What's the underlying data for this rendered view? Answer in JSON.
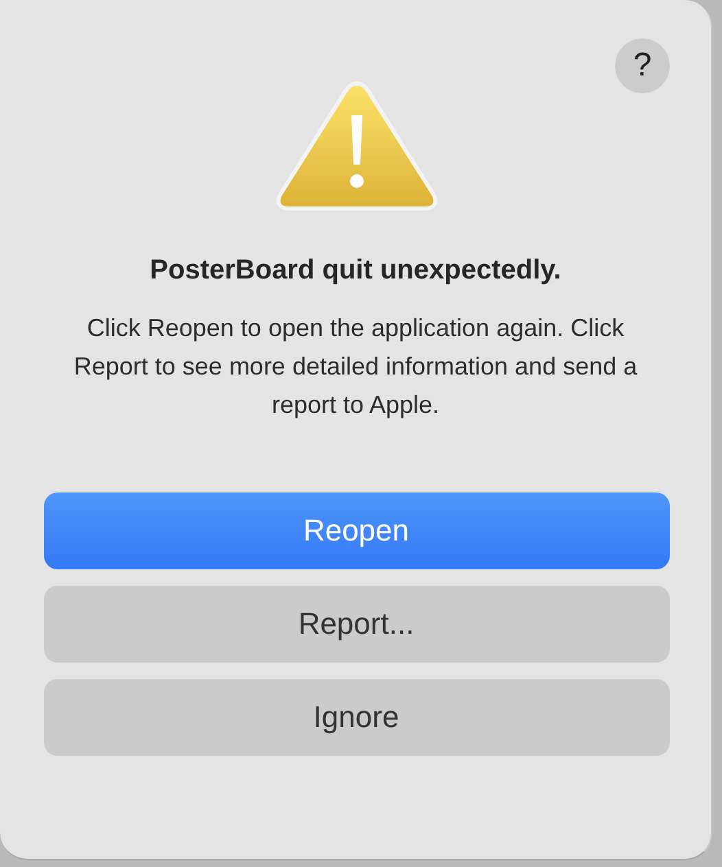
{
  "help_button": {
    "label": "?"
  },
  "alert": {
    "title": "PosterBoard quit unexpectedly.",
    "message": "Click Reopen to open the application again. Click Report to see more detailed information and send a report to Apple."
  },
  "buttons": [
    {
      "label": "Reopen",
      "kind": "default"
    },
    {
      "label": "Report...",
      "kind": "normal"
    },
    {
      "label": "Ignore",
      "kind": "normal"
    }
  ]
}
